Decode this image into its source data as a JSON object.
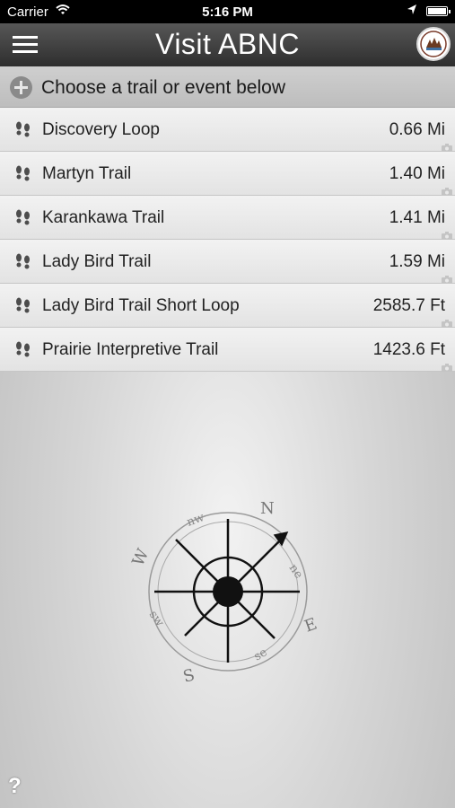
{
  "status": {
    "carrier": "Carrier",
    "time": "5:16 PM"
  },
  "nav": {
    "title": "Visit ABNC",
    "menu_icon": "hamburger-menu-icon",
    "logo_icon": "organization-logo-icon"
  },
  "chooser": {
    "label": "Choose a trail or event below",
    "icon": "plus-circle-icon"
  },
  "trails": [
    {
      "name": "Discovery Loop",
      "distance": "0.66 Mi"
    },
    {
      "name": "Martyn Trail",
      "distance": "1.40 Mi"
    },
    {
      "name": "Karankawa Trail",
      "distance": "1.41 Mi"
    },
    {
      "name": "Lady Bird Trail",
      "distance": "1.59 Mi"
    },
    {
      "name": "Lady Bird Trail Short Loop",
      "distance": "2585.7 Ft"
    },
    {
      "name": "Prairie Interpretive Trail",
      "distance": "1423.6 Ft"
    }
  ],
  "compass": {
    "labels": {
      "n": "N",
      "e": "E",
      "s": "S",
      "w": "W",
      "nw": "nw",
      "ne": "ne",
      "se": "se",
      "sw": "sw"
    }
  },
  "help": {
    "label": "?"
  },
  "colors": {
    "navbar": "#3a3a3a",
    "row": "#ececec",
    "background": "#d0d0d0"
  }
}
